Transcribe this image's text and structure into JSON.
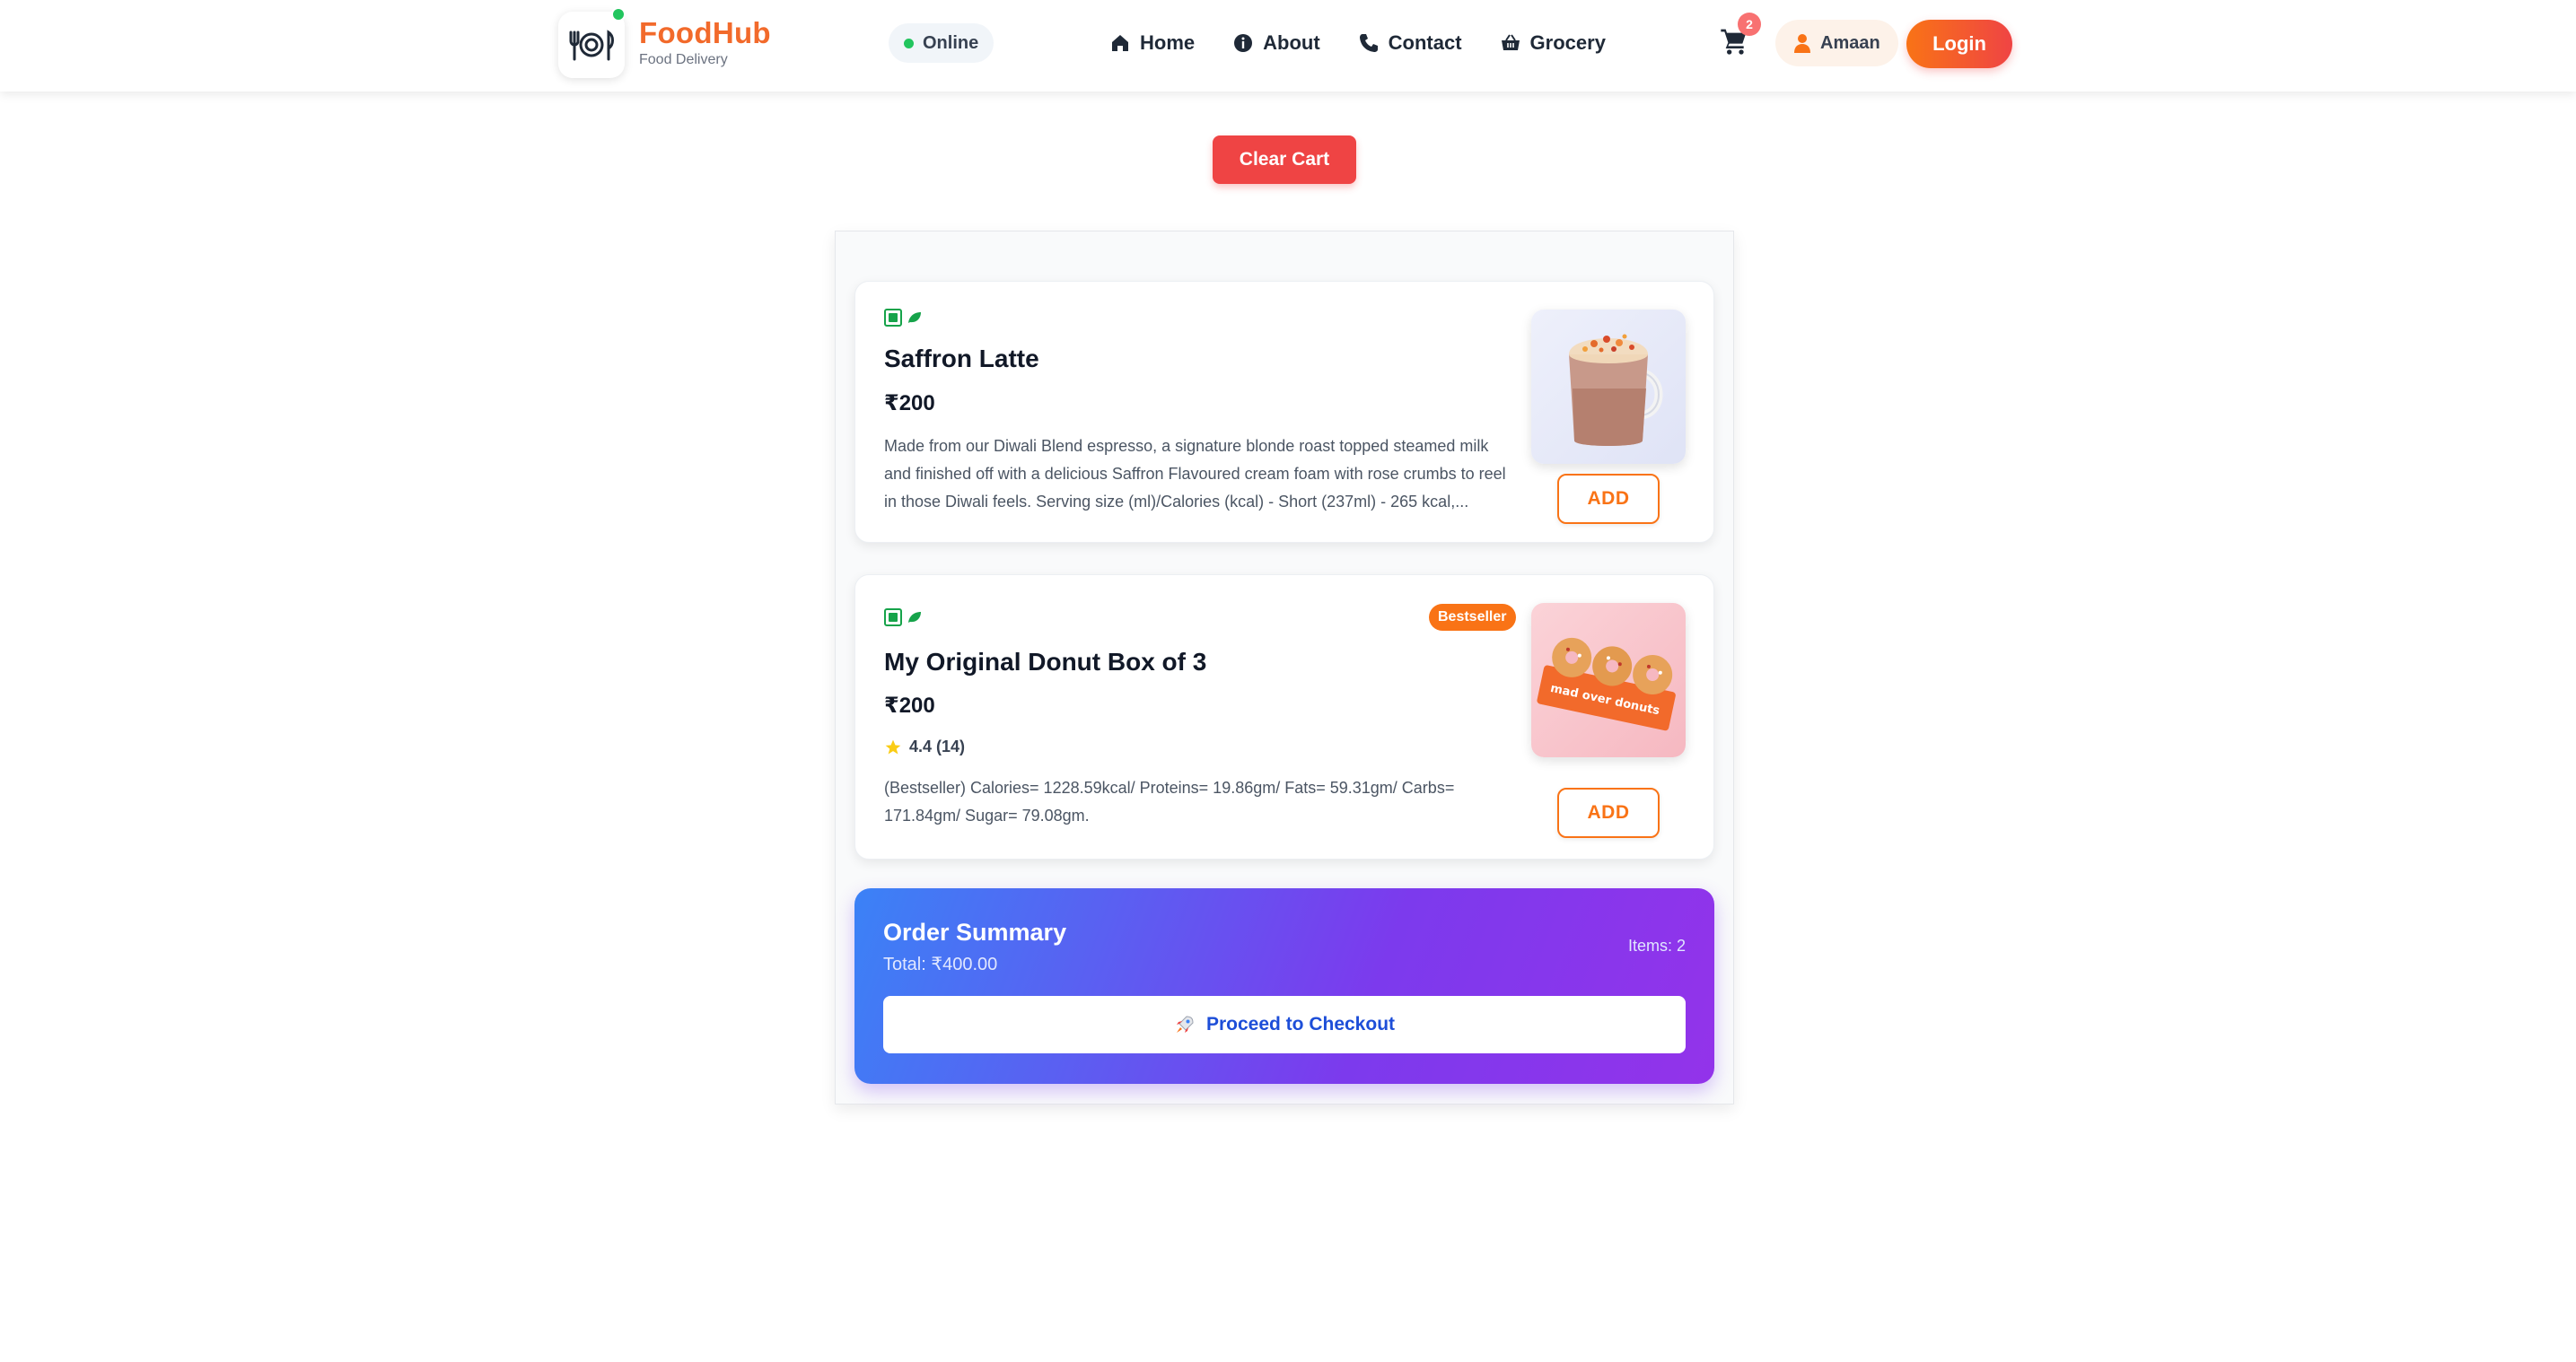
{
  "header": {
    "brand_name": "FoodHub",
    "brand_sub": "Food Delivery",
    "status": "Online",
    "nav": [
      {
        "label": "Home",
        "icon": "home-icon"
      },
      {
        "label": "About",
        "icon": "info-icon"
      },
      {
        "label": "Contact",
        "icon": "phone-icon"
      },
      {
        "label": "Grocery",
        "icon": "basket-icon"
      }
    ],
    "cart_count": "2",
    "user_name": "Amaan",
    "login_label": "Login"
  },
  "cart": {
    "clear_label": "Clear Cart",
    "items": [
      {
        "title": "Saffron Latte",
        "price": "₹200",
        "description": "Made from our Diwali Blend espresso, a signature blonde roast topped steamed milk and finished off with a delicious Saffron Flavoured cream foam with rose crumbs to reel in those Diwali feels. Serving size (ml)/Calories (kcal) - Short (237ml) - 265 kcal,...",
        "add_label": "ADD"
      },
      {
        "title": "My Original Donut Box of 3",
        "price": "₹200",
        "badge": "Bestseller",
        "rating": "4.4 (14)",
        "description": "(Bestseller) Calories= 1228.59kcal/ Proteins= 19.86gm/ Fats= 59.31gm/ Carbs= 171.84gm/ Sugar= 79.08gm.",
        "image_text": "mad over donuts",
        "add_label": "ADD"
      }
    ]
  },
  "summary": {
    "title": "Order Summary",
    "total": "Total: ₹400.00",
    "items": "Items: 2",
    "checkout_label": "Proceed to Checkout",
    "checkout_icon": "rocket-icon"
  },
  "colors": {
    "brand": "#f26a2b",
    "accent": "#f97316",
    "danger": "#ef4444",
    "veg": "#16a34a",
    "summary_start": "#3b82f6",
    "summary_end": "#9333ea"
  }
}
